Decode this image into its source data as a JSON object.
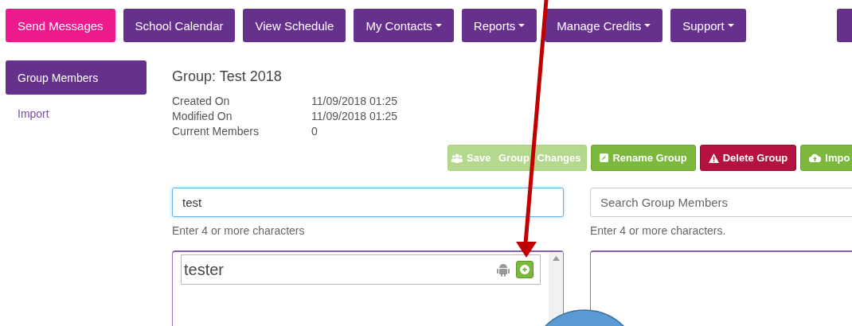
{
  "nav": [
    {
      "label": "Send Messages",
      "selected": true,
      "dropdown": false
    },
    {
      "label": "School Calendar",
      "selected": false,
      "dropdown": false
    },
    {
      "label": "View Schedule",
      "selected": false,
      "dropdown": false
    },
    {
      "label": "My Contacts",
      "selected": false,
      "dropdown": true
    },
    {
      "label": "Reports",
      "selected": false,
      "dropdown": true
    },
    {
      "label": "Manage Credits",
      "selected": false,
      "dropdown": true
    },
    {
      "label": "Support",
      "selected": false,
      "dropdown": true
    }
  ],
  "sidebar": {
    "items": [
      {
        "label": "Group Members",
        "selected": true
      },
      {
        "label": "Import",
        "selected": false
      }
    ]
  },
  "group": {
    "title": "Group: Test 2018",
    "info": [
      {
        "label": "Created On",
        "value": "11/09/2018 01:25"
      },
      {
        "label": "Modified On",
        "value": "11/09/2018 01:25"
      },
      {
        "label": "Current Members",
        "value": "0"
      }
    ]
  },
  "actions": [
    {
      "label": "Save Group Changes",
      "kind": "save",
      "disabled": true
    },
    {
      "label": "Rename Group",
      "kind": "rename",
      "disabled": false
    },
    {
      "label": "Delete Group",
      "kind": "delete",
      "disabled": false
    },
    {
      "label": "Impo",
      "kind": "import",
      "disabled": false
    }
  ],
  "contact_search": {
    "value": "test",
    "hint": "Enter 4 or more characters",
    "results": [
      {
        "name": "tester"
      }
    ]
  },
  "member_search": {
    "placeholder": "Search Group Members",
    "hint": "Enter 4 or more characters."
  }
}
